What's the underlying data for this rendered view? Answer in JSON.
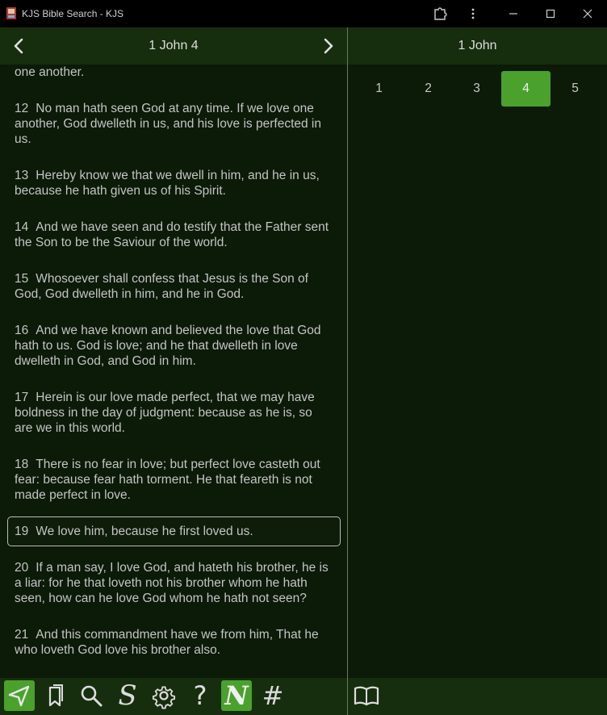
{
  "window": {
    "title": "KJS Bible Search - KJS"
  },
  "left_pane": {
    "title": "1 John 4",
    "verses": [
      {
        "num": "",
        "text": "one another."
      },
      {
        "num": "12",
        "text": "No man hath seen God at any time. If we love one another, God dwelleth in us, and his love is perfected in us."
      },
      {
        "num": "13",
        "text": "Hereby know we that we dwell in him, and he in us, because he hath given us of his Spirit."
      },
      {
        "num": "14",
        "text": "And we have seen and do testify that the Father sent the Son to be the Saviour of the world."
      },
      {
        "num": "15",
        "text": "Whosoever shall confess that Jesus is the Son of God, God dwelleth in him, and he in God."
      },
      {
        "num": "16",
        "text": "And we have known and believed the love that God hath to us. God is love; and he that dwelleth in love dwelleth in God, and God in him."
      },
      {
        "num": "17",
        "text": "Herein is our love made perfect, that we may have boldness in the day of judgment: because as he is, so are we in this world."
      },
      {
        "num": "18",
        "text": "There is no fear in love; but perfect love casteth out fear: because fear hath torment. He that feareth is not made perfect in love."
      },
      {
        "num": "19",
        "text": "We love him, because he first loved us."
      },
      {
        "num": "20",
        "text": "If a man say, I love God, and hateth his brother, he is a liar: for he that loveth not his brother whom he hath seen, how can he love God whom he hath not seen?"
      },
      {
        "num": "21",
        "text": "And this commandment have we from him, That he who loveth God love his brother also."
      }
    ],
    "selected_verse": "19"
  },
  "right_pane": {
    "title": "1 John",
    "chapters": [
      "1",
      "2",
      "3",
      "4",
      "5"
    ],
    "active_chapter": "4"
  },
  "toolbar": {
    "tools": [
      {
        "icon": "navigate-arrow-icon",
        "active": true
      },
      {
        "icon": "bookmarks-icon",
        "active": false
      },
      {
        "icon": "search-icon",
        "active": false
      },
      {
        "icon": "strongs-s-icon",
        "glyph": "S",
        "active": false
      },
      {
        "icon": "gear-icon",
        "active": false
      },
      {
        "icon": "help-question-icon",
        "glyph": "?",
        "active": false
      },
      {
        "icon": "notes-n-icon",
        "glyph": "N",
        "active": true
      },
      {
        "icon": "hash-icon",
        "glyph": "#",
        "active": false
      }
    ],
    "right_tool": {
      "icon": "open-book-icon"
    }
  },
  "colors": {
    "accent": "#4aa12c",
    "header_bg": "#172e0e",
    "pane_bg": "#0c1a08",
    "titlebar_bg": "#000000",
    "text": "#c4c4c4"
  }
}
